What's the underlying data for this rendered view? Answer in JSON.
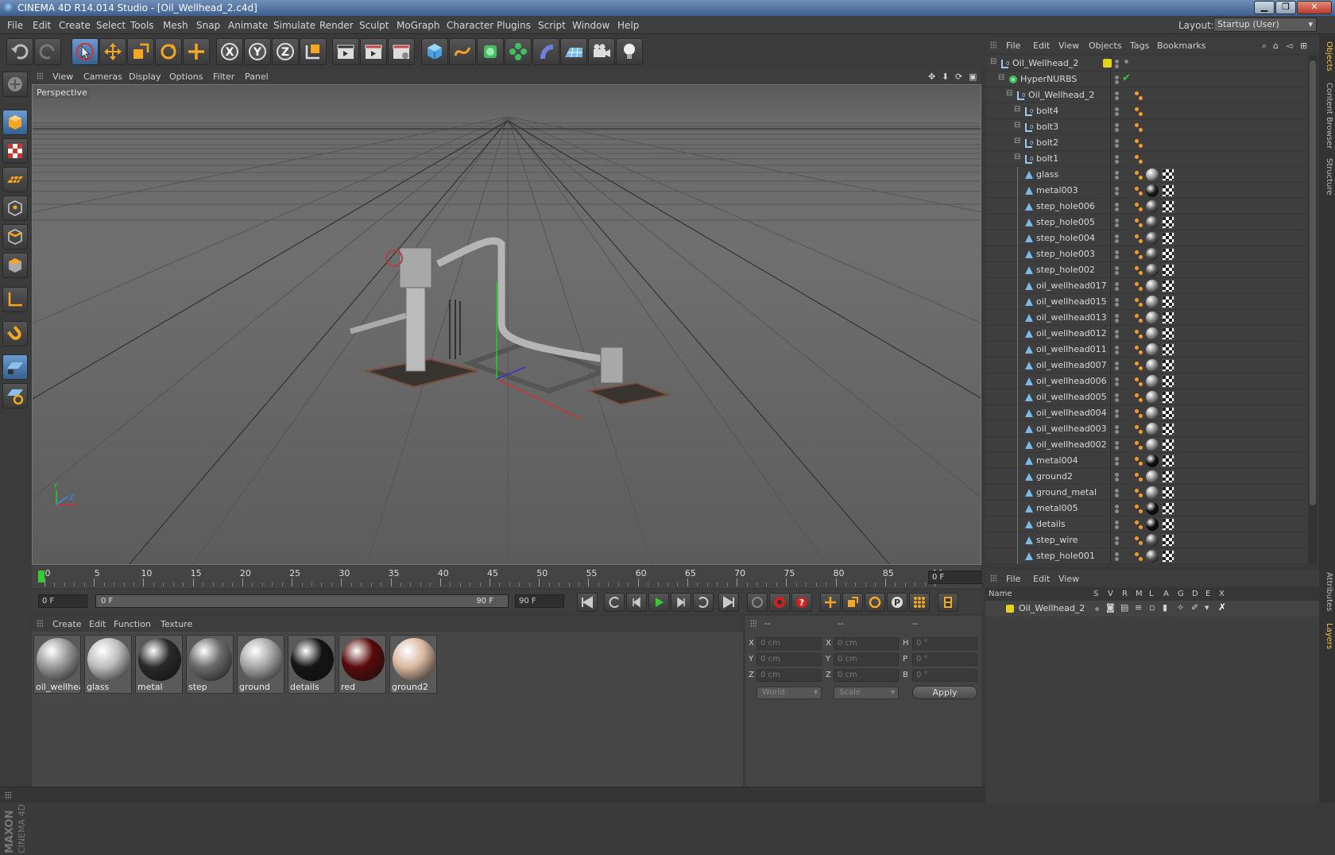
{
  "window": {
    "title": "CINEMA 4D R14.014 Studio - [Oil_Wellhead_2.c4d]",
    "controls": [
      "▁",
      "❐",
      "✕"
    ]
  },
  "menu": [
    "File",
    "Edit",
    "Create",
    "Select",
    "Tools",
    "Mesh",
    "Snap",
    "Animate",
    "Simulate",
    "Render",
    "Sculpt",
    "MoGraph",
    "Character",
    "Plugins",
    "Script",
    "Window",
    "Help"
  ],
  "layout": {
    "label": "Layout:",
    "value": "Startup (User)"
  },
  "viewport": {
    "menu": [
      "View",
      "Cameras",
      "Display",
      "Options",
      "Filter",
      "Panel"
    ],
    "camera_label": "Perspective",
    "axis": {
      "y": "Y",
      "z": "Z",
      "x": "X"
    }
  },
  "timeline": {
    "ticks": [
      "0",
      "5",
      "10",
      "15",
      "20",
      "25",
      "30",
      "35",
      "40",
      "45",
      "50",
      "55",
      "60",
      "65",
      "70",
      "75",
      "80",
      "85",
      "90"
    ],
    "current_frame": "0 F"
  },
  "transport": {
    "start_field": "0 F",
    "range_start": "0 F",
    "range_end": "90 F",
    "end_field": "90 F"
  },
  "material_manager": {
    "menu": [
      "Create",
      "Edit",
      "Function",
      "Texture"
    ],
    "materials": [
      {
        "name": "oil_wellhea",
        "color": "#9a9a9a"
      },
      {
        "name": "glass",
        "color": "#bdbdbd"
      },
      {
        "name": "metal",
        "color": "#2a2a2a"
      },
      {
        "name": "step",
        "color": "#6d6d6d"
      },
      {
        "name": "ground",
        "color": "#a8a8a8"
      },
      {
        "name": "details",
        "color": "#141414"
      },
      {
        "name": "red",
        "color": "#5a0a0a"
      },
      {
        "name": "ground2",
        "color": "#d9b8a0"
      }
    ]
  },
  "coordinates": {
    "header": [
      "--",
      "--",
      "--"
    ],
    "rows": [
      {
        "a": "X",
        "av": "0 cm",
        "b": "X",
        "bv": "0 cm",
        "c": "H",
        "cv": "0 °"
      },
      {
        "a": "Y",
        "av": "0 cm",
        "b": "Y",
        "bv": "0 cm",
        "c": "P",
        "cv": "0 °"
      },
      {
        "a": "Z",
        "av": "0 cm",
        "b": "Z",
        "bv": "0 cm",
        "c": "B",
        "cv": "0 °"
      }
    ],
    "space_select": "World",
    "mode_select": "Scale",
    "apply": "Apply"
  },
  "object_manager": {
    "menu": [
      "File",
      "Edit",
      "View",
      "Objects",
      "Tags",
      "Bookmarks"
    ],
    "objects": [
      {
        "name": "Oil_Wellhead_2",
        "level": 0,
        "type": "null",
        "tags": "layer"
      },
      {
        "name": "HyperNURBS",
        "level": 1,
        "type": "nurbs",
        "tags": "check"
      },
      {
        "name": "Oil_Wellhead_2",
        "level": 2,
        "type": "null",
        "tags": "phong"
      },
      {
        "name": "bolt4",
        "level": 3,
        "type": "null",
        "tags": "phong"
      },
      {
        "name": "bolt3",
        "level": 3,
        "type": "null",
        "tags": "phong"
      },
      {
        "name": "bolt2",
        "level": 3,
        "type": "null",
        "tags": "phong"
      },
      {
        "name": "bolt1",
        "level": 3,
        "type": "null",
        "tags": "phong"
      },
      {
        "name": "glass",
        "level": 3,
        "type": "poly",
        "tags": "mat",
        "mat": "#9c9c9c"
      },
      {
        "name": "metal003",
        "level": 3,
        "type": "poly",
        "tags": "mat",
        "mat": "#1c1c1c"
      },
      {
        "name": "step_hole006",
        "level": 3,
        "type": "poly",
        "tags": "mat",
        "mat": "#555"
      },
      {
        "name": "step_hole005",
        "level": 3,
        "type": "poly",
        "tags": "mat",
        "mat": "#555"
      },
      {
        "name": "step_hole004",
        "level": 3,
        "type": "poly",
        "tags": "mat",
        "mat": "#555"
      },
      {
        "name": "step_hole003",
        "level": 3,
        "type": "poly",
        "tags": "mat",
        "mat": "#555"
      },
      {
        "name": "step_hole002",
        "level": 3,
        "type": "poly",
        "tags": "mat",
        "mat": "#555"
      },
      {
        "name": "oil_wellhead017",
        "level": 3,
        "type": "poly",
        "tags": "mat",
        "mat": "#8a8a8a"
      },
      {
        "name": "oil_wellhead015",
        "level": 3,
        "type": "poly",
        "tags": "mat",
        "mat": "#8a8a8a"
      },
      {
        "name": "oil_wellhead013",
        "level": 3,
        "type": "poly",
        "tags": "mat",
        "mat": "#8a8a8a"
      },
      {
        "name": "oil_wellhead012",
        "level": 3,
        "type": "poly",
        "tags": "mat",
        "mat": "#8a8a8a"
      },
      {
        "name": "oil_wellhead011",
        "level": 3,
        "type": "poly",
        "tags": "mat",
        "mat": "#8a8a8a"
      },
      {
        "name": "oil_wellhead007",
        "level": 3,
        "type": "poly",
        "tags": "mat",
        "mat": "#8a8a8a"
      },
      {
        "name": "oil_wellhead006",
        "level": 3,
        "type": "poly",
        "tags": "mat",
        "mat": "#8a8a8a"
      },
      {
        "name": "oil_wellhead005",
        "level": 3,
        "type": "poly",
        "tags": "mat",
        "mat": "#8a8a8a"
      },
      {
        "name": "oil_wellhead004",
        "level": 3,
        "type": "poly",
        "tags": "mat",
        "mat": "#8a8a8a"
      },
      {
        "name": "oil_wellhead003",
        "level": 3,
        "type": "poly",
        "tags": "mat",
        "mat": "#8a8a8a"
      },
      {
        "name": "oil_wellhead002",
        "level": 3,
        "type": "poly",
        "tags": "mat",
        "mat": "#8a8a8a"
      },
      {
        "name": "metal004",
        "level": 3,
        "type": "poly",
        "tags": "mat",
        "mat": "#111"
      },
      {
        "name": "ground2",
        "level": 3,
        "type": "poly",
        "tags": "mat",
        "mat": "#8a8a8a"
      },
      {
        "name": "ground_metal",
        "level": 3,
        "type": "poly",
        "tags": "mat",
        "mat": "#8a8a8a"
      },
      {
        "name": "metal005",
        "level": 3,
        "type": "poly",
        "tags": "mat",
        "mat": "#111"
      },
      {
        "name": "details",
        "level": 3,
        "type": "poly",
        "tags": "mat",
        "mat": "#111"
      },
      {
        "name": "step_wire",
        "level": 3,
        "type": "poly",
        "tags": "mat",
        "mat": "#555"
      },
      {
        "name": "step_hole001",
        "level": 3,
        "type": "poly",
        "tags": "mat",
        "mat": "#555"
      }
    ]
  },
  "layer_manager": {
    "menu": [
      "File",
      "Edit",
      "View"
    ],
    "columns": [
      "Name",
      "S",
      "V",
      "R",
      "M",
      "L",
      "A",
      "G",
      "D",
      "E",
      "X"
    ],
    "layer": {
      "name": "Oil_Wellhead_2",
      "color": "#e6d21a"
    }
  },
  "right_tabs": [
    "Objects",
    "Content Browser",
    "Structure",
    "Attributes",
    "Layers"
  ],
  "colors": {
    "accent": "#6b9bd2",
    "highlight": "#f39c2a",
    "layer_yellow": "#e6d21a"
  },
  "branding": "MAXON CINEMA 4D"
}
